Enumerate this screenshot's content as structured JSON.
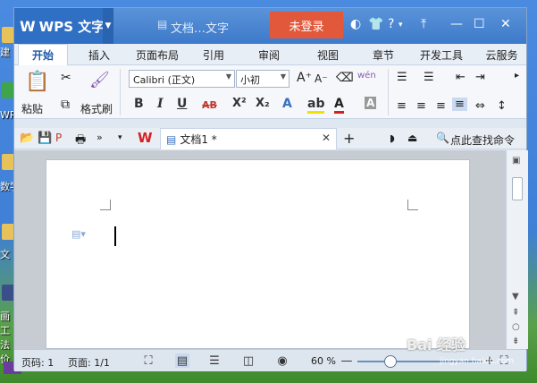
{
  "app": {
    "name": "WPS 文字",
    "window_title": "文档…文字",
    "login_label": "未登录"
  },
  "desktop": {
    "icons": [
      "建",
      "WPS",
      "数学",
      "文",
      "画工 法价"
    ]
  },
  "tabs": [
    "开始",
    "插入",
    "页面布局",
    "引用",
    "审阅",
    "视图",
    "章节",
    "开发工具",
    "云服务"
  ],
  "ribbon": {
    "paste_label": "粘贴",
    "format_painter_label": "格式刷",
    "font_name": "Calibri (正文)",
    "font_size": "小初",
    "bold": "B",
    "italic": "I",
    "underline": "U",
    "strikethrough": "AB",
    "superscript": "X²",
    "subscript": "X₂",
    "pinyin": "wén"
  },
  "toolbar2": {
    "doc_tab_label": "文档1 *",
    "search_label": "点此查找命令"
  },
  "statusbar": {
    "page_no": "页码: 1",
    "page_count": "页面: 1/1",
    "zoom_label": "60 %",
    "zoom_percent": 60
  },
  "watermark": {
    "text": "Bai 经验",
    "url_text": "jingyan.baidu.com"
  },
  "colors": {
    "accent": "#3e7acb",
    "login": "#e2583b",
    "active_tab_text": "#1e5aa8"
  }
}
